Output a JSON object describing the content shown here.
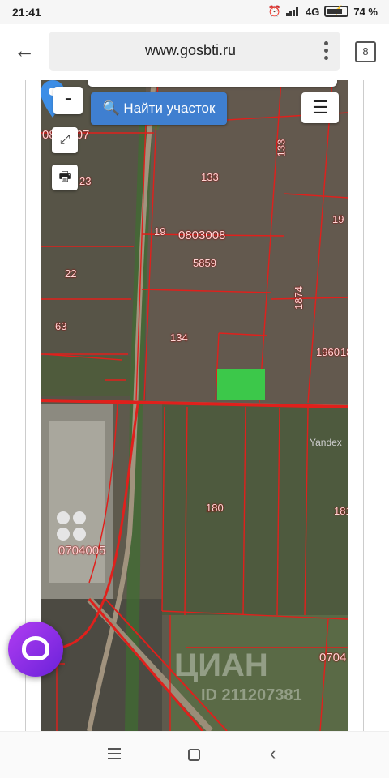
{
  "status_bar": {
    "time": "21:41",
    "network": "4G",
    "battery": "74 %",
    "icons": [
      "alarm-icon",
      "signal-icon",
      "battery-charging-icon"
    ]
  },
  "browser": {
    "url": "www.gosbti.ru",
    "tab_count": "8",
    "back_icon": "arrow-left-icon",
    "menu_icon": "kebab-menu-icon"
  },
  "map": {
    "controls": {
      "zoom_out": "-",
      "expand_icon": "⤢",
      "print_icon": "🖶",
      "menu_icon": "☰",
      "find_button": "Найти участок",
      "search_icon": "🔍"
    },
    "parcel_labels": [
      "0803007",
      "23",
      "133",
      "133",
      "19",
      "0803008",
      "19",
      "22",
      "5859",
      "1874",
      "63",
      "134",
      "1960",
      "18",
      "180",
      "181",
      "0704005",
      "0704"
    ],
    "attribution": "Yandex",
    "watermark": "ЦИАН",
    "watermark_id": "ID 211207381",
    "selected_parcel_color": "#3cc84a",
    "boundary_color": "#e0201c"
  },
  "assistant_button": {
    "icon": "alice-assistant-icon"
  },
  "nav_bar": {
    "icons": [
      "recent-apps-icon",
      "home-icon",
      "back-icon"
    ]
  }
}
